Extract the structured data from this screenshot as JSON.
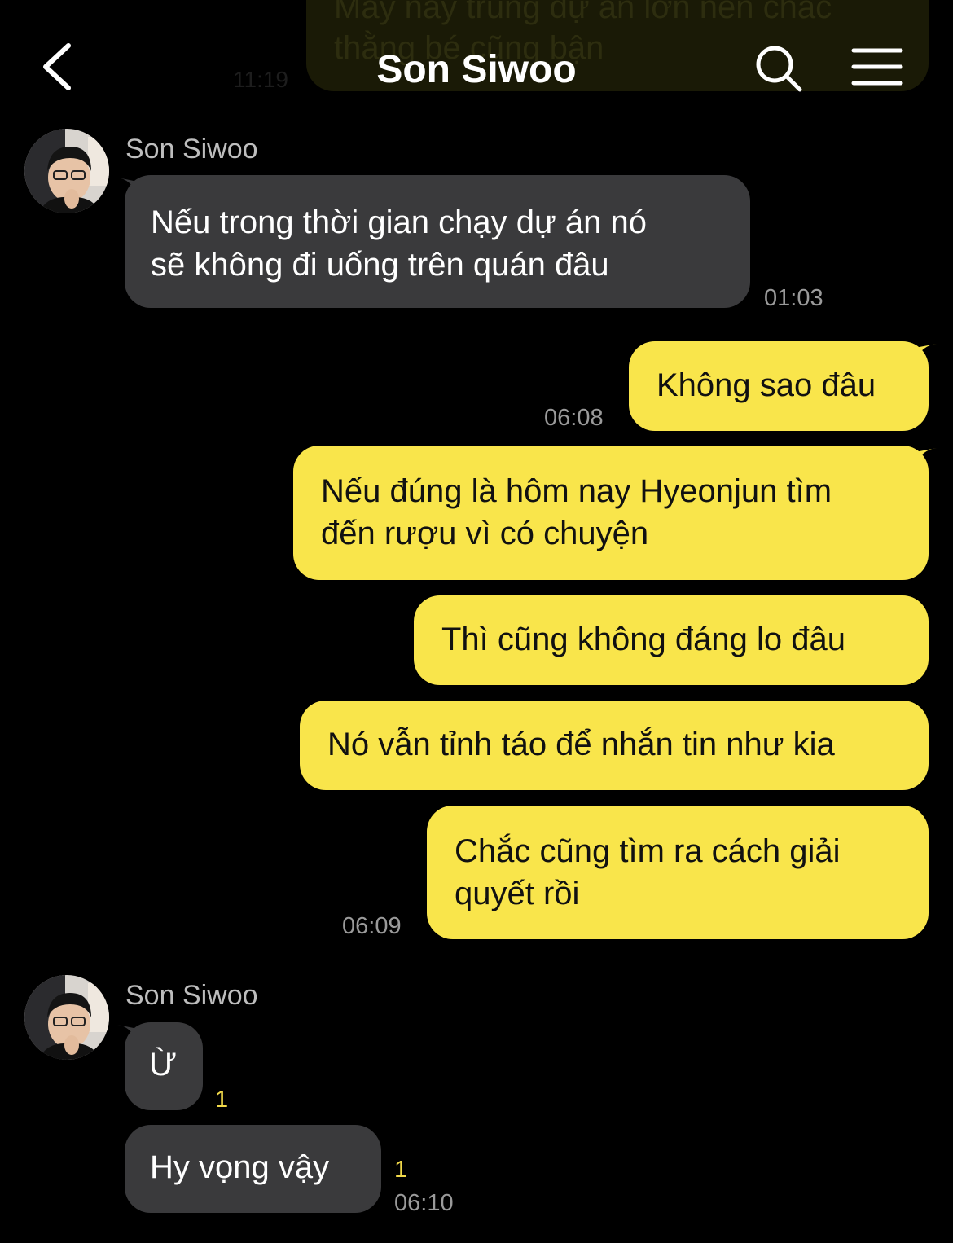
{
  "header": {
    "title": "Son Siwoo"
  },
  "ghost": {
    "text": "Mấy nay trúng dự án lớn nên chắc thằng bé cũng bận",
    "time": "11:19"
  },
  "messages": {
    "m1": {
      "sender": "Son Siwoo",
      "line1": "Nếu trong thời gian chạy dự án nó",
      "line2": "sẽ không đi uống trên quán đâu",
      "time": "01:03"
    },
    "m2": {
      "text": "Không sao đâu",
      "time": "06:08"
    },
    "m3": {
      "line1": "Nếu đúng là hôm nay Hyeonjun tìm",
      "line2": "đến rượu vì có chuyện"
    },
    "m4": {
      "text": "Thì cũng không đáng lo đâu"
    },
    "m5": {
      "text": "Nó vẫn tỉnh táo để nhắn tin như kia"
    },
    "m6": {
      "line1": "Chắc cũng tìm ra cách giải",
      "line2": "quyết rồi",
      "time": "06:09"
    },
    "m7": {
      "sender": "Son Siwoo",
      "text": "Ừ",
      "unread": "1"
    },
    "m8": {
      "text": "Hy vọng vậy",
      "unread": "1",
      "time": "06:10"
    }
  },
  "colors": {
    "outgoing": "#f9e54b",
    "incoming": "#3a3a3c",
    "background": "#000000"
  },
  "icons": [
    "back-chevron-icon",
    "search-icon",
    "menu-icon",
    "avatar"
  ]
}
